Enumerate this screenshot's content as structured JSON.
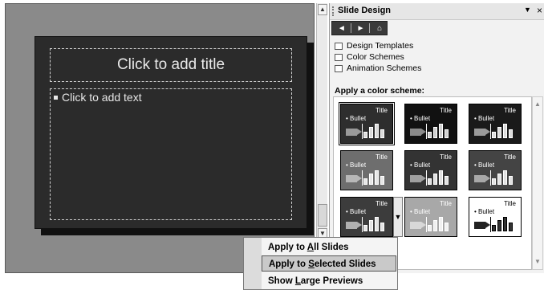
{
  "slide": {
    "title_placeholder": "Click to add title",
    "body_placeholder": "Click to add text"
  },
  "pane": {
    "title": "Slide Design",
    "links": [
      "Design Templates",
      "Color Schemes",
      "Animation Schemes"
    ],
    "section_label": "Apply a color scheme:"
  },
  "schemes": [
    {
      "title": "Title",
      "bullet": "• Bullet",
      "bg": "#2e2e2e",
      "fg": "#ffffff",
      "arrow": "#9a9a9a",
      "bars": "#dcdcdc"
    },
    {
      "title": "Title",
      "bullet": "• Bullet",
      "bg": "#111111",
      "fg": "#ffffff",
      "arrow": "#8a8a8a",
      "bars": "#cfcfcf"
    },
    {
      "title": "Title",
      "bullet": "• Bullet",
      "bg": "#1a1a1a",
      "fg": "#ffffff",
      "arrow": "#9a9a9a",
      "bars": "#dddddd"
    },
    {
      "title": "Title",
      "bullet": "• Bullet",
      "bg": "#6e6e6e",
      "fg": "#ffffff",
      "arrow": "#b8b8b8",
      "bars": "#e6e6e6"
    },
    {
      "title": "Title",
      "bullet": "• Bullet",
      "bg": "#333333",
      "fg": "#ffffff",
      "arrow": "#a0a0a0",
      "bars": "#e0e0e0"
    },
    {
      "title": "Title",
      "bullet": "• Bullet",
      "bg": "#444444",
      "fg": "#ffffff",
      "arrow": "#a8a8a8",
      "bars": "#e2e2e2"
    },
    {
      "title": "Title",
      "bullet": "• Bullet",
      "bg": "#3c3c3c",
      "fg": "#ffffff",
      "arrow": "#b0b0b0",
      "bars": "#e4e4e4"
    },
    {
      "title": "Title",
      "bullet": "• Bullet",
      "bg": "#a8a8a8",
      "fg": "#ffffff",
      "arrow": "#d8d8d8",
      "bars": "#f0f0f0"
    },
    {
      "title": "Title",
      "bullet": "• Bullet",
      "bg": "#ffffff",
      "fg": "#000000",
      "arrow": "#222222",
      "bars": "#333333"
    }
  ],
  "menu": {
    "items": [
      {
        "pre": "Apply to ",
        "key": "A",
        "post": "ll Slides"
      },
      {
        "pre": "Apply to ",
        "key": "S",
        "post": "elected Slides"
      },
      {
        "pre": "Show ",
        "key": "L",
        "post": "arge Previews"
      }
    ]
  }
}
